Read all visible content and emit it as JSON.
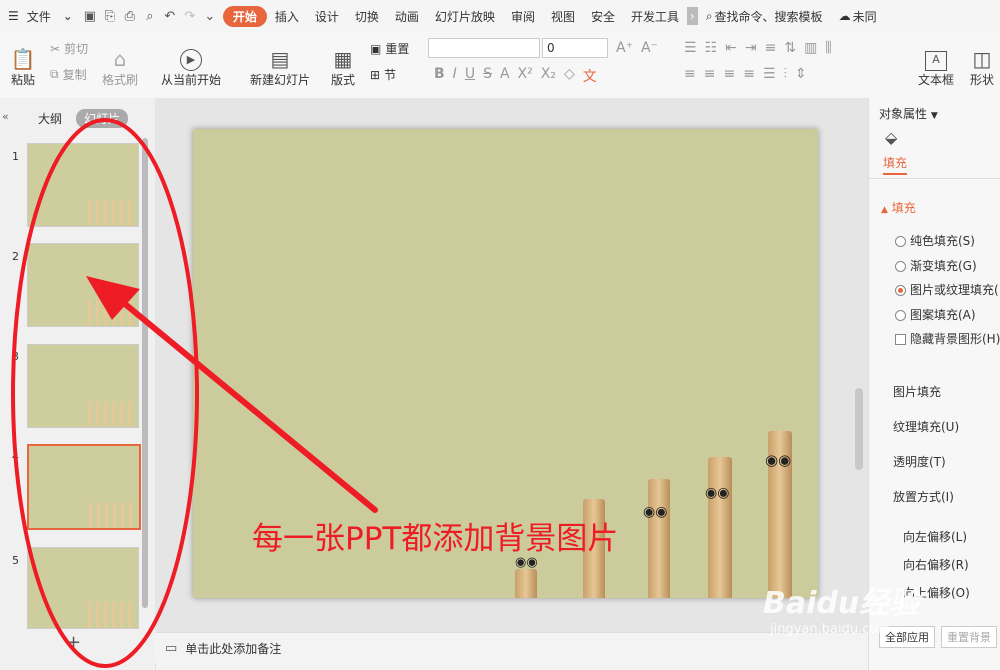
{
  "menubar": {
    "file": "文件",
    "tabs": [
      "开始",
      "插入",
      "设计",
      "切换",
      "动画",
      "幻灯片放映",
      "审阅",
      "视图",
      "安全",
      "开发工具"
    ],
    "active_tab": "开始",
    "search": "查找命令、搜索模板",
    "sync": "未同"
  },
  "ribbon": {
    "paste": "粘贴",
    "cut": "剪切",
    "copy": "复制",
    "format_painter": "格式刷",
    "from_current": "从当前开始",
    "new_slide": "新建幻灯片",
    "layout": "版式",
    "reset": "重置",
    "section": "节",
    "font_size": "0",
    "textbox": "文本框",
    "shape": "形状"
  },
  "left_panel": {
    "tab_outline": "大纲",
    "tab_slides": "幻灯片",
    "slide_numbers": [
      "1",
      "2",
      "3",
      "4",
      "5"
    ],
    "add_icon": "plus-icon"
  },
  "notes": {
    "placeholder": "单击此处添加备注"
  },
  "right_panel": {
    "title": "对象属性",
    "fill_tab": "填充",
    "section": "填充",
    "options": [
      "纯色填充(S)",
      "渐变填充(G)",
      "图片或纹理填充(",
      "图案填充(A)"
    ],
    "selected_option": 2,
    "hide_bg": "隐藏背景图形(H)",
    "picture_fill": "图片填充",
    "texture_fill": "纹理填充(U)",
    "transparency": "透明度(T)",
    "placement": "放置方式(I)",
    "offset_left": "向左偏移(L)",
    "offset_right": "向右偏移(R)",
    "offset_up": "向上偏移(O)",
    "apply_all": "全部应用",
    "reset_bg": "重置背景"
  },
  "annotation": {
    "text": "每一张PPT都添加背景图片",
    "color": "#ee1c25"
  },
  "watermark": {
    "brand": "Baidu经验",
    "url": "jingyan.baidu.com"
  },
  "colors": {
    "accent": "#e8663d",
    "slide_bg": "#cccb9c"
  }
}
